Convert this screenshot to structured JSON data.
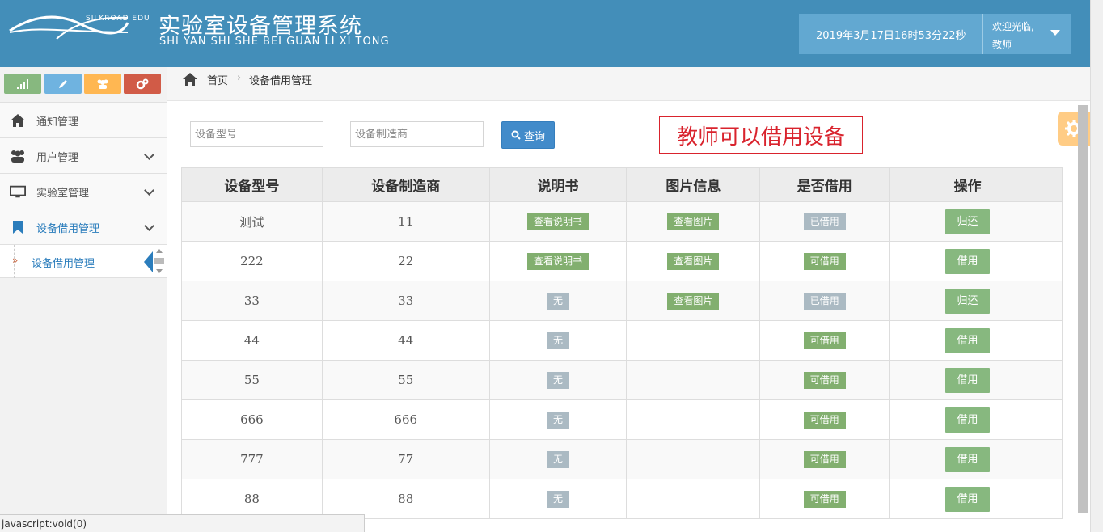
{
  "header": {
    "logo_text": "SILKROAD EDU",
    "title": "实验室设备管理系统",
    "subtitle": "SHI YAN SHI SHE BEI GUAN LI XI TONG",
    "datetime": "2019年3月17日16时53分22秒",
    "welcome_line1": "欢迎光临,",
    "welcome_line2": "教师"
  },
  "sidebar": {
    "shortcuts": [
      {
        "icon": "signal-icon",
        "color": "#87b87f"
      },
      {
        "icon": "pencil-icon",
        "color": "#6fb3e0"
      },
      {
        "icon": "users-icon",
        "color": "#ffb752"
      },
      {
        "icon": "cogs-icon",
        "color": "#d15b47"
      }
    ],
    "items": [
      {
        "label": "通知管理",
        "icon": "home-icon"
      },
      {
        "label": "用户管理",
        "icon": "users-icon"
      },
      {
        "label": "实验室管理",
        "icon": "desktop-icon"
      },
      {
        "label": "设备借用管理",
        "icon": "bookmark-icon"
      }
    ],
    "sub_items": [
      {
        "label": "设备借用管理"
      }
    ]
  },
  "breadcrumb": {
    "home": "首页",
    "separator": "›",
    "current": "设备借用管理"
  },
  "search": {
    "model_placeholder": "设备型号",
    "maker_placeholder": "设备制造商",
    "button_label": "查询"
  },
  "notice": "教师可以借用设备",
  "table": {
    "headers": [
      "设备型号",
      "设备制造商",
      "说明书",
      "图片信息",
      "是否借用",
      "操作"
    ],
    "rows": [
      {
        "model": "测试",
        "maker": "11",
        "manual": "查看说明书",
        "image": "查看图片",
        "status": "已借用",
        "action": "归还"
      },
      {
        "model": "222",
        "maker": "22",
        "manual": "查看说明书",
        "image": "查看图片",
        "status": "可借用",
        "action": "借用"
      },
      {
        "model": "33",
        "maker": "33",
        "manual": "无",
        "image": "查看图片",
        "status": "已借用",
        "action": "归还"
      },
      {
        "model": "44",
        "maker": "44",
        "manual": "无",
        "image": "",
        "status": "可借用",
        "action": "借用"
      },
      {
        "model": "55",
        "maker": "55",
        "manual": "无",
        "image": "",
        "status": "可借用",
        "action": "借用"
      },
      {
        "model": "666",
        "maker": "666",
        "manual": "无",
        "image": "",
        "status": "可借用",
        "action": "借用"
      },
      {
        "model": "777",
        "maker": "77",
        "manual": "无",
        "image": "",
        "status": "可借用",
        "action": "借用"
      },
      {
        "model": "88",
        "maker": "88",
        "manual": "无",
        "image": "",
        "status": "可借用",
        "action": "借用"
      }
    ]
  },
  "status_bar": "javascript:void(0)",
  "colors": {
    "header": "#438eb9",
    "accent": "#2b7dbc",
    "green": "#87b87f",
    "grey_label": "#abbac3",
    "notice_red": "#d9232d"
  }
}
